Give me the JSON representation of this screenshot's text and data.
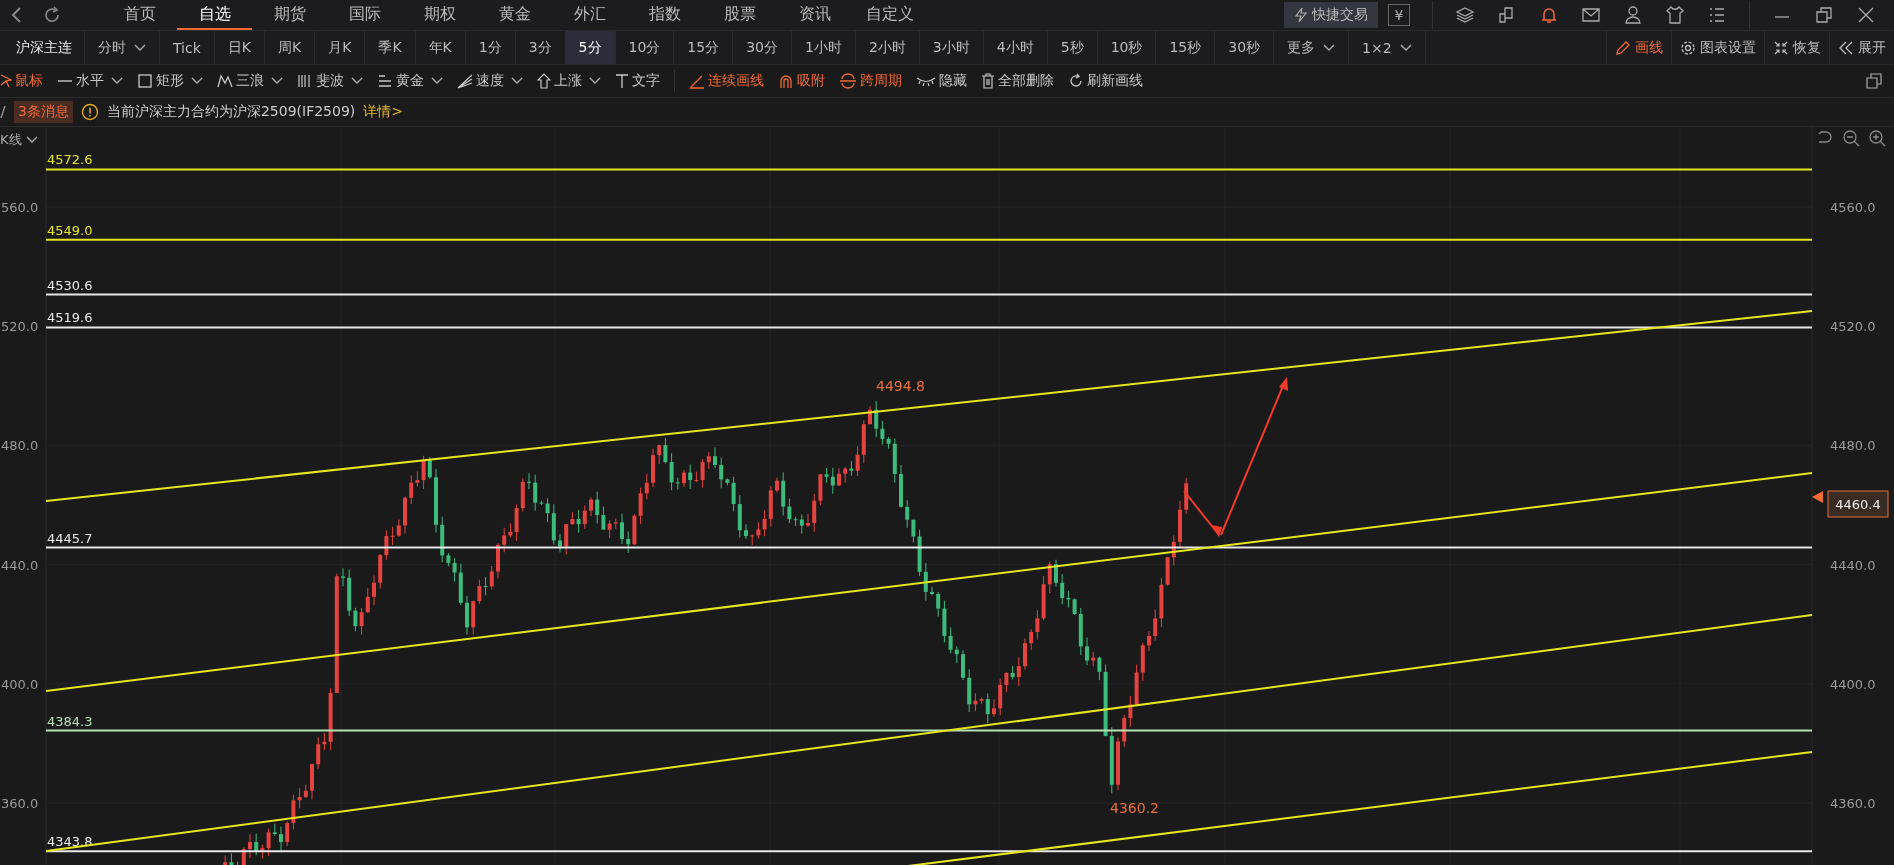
{
  "nav": {
    "tabs": [
      {
        "label": "首页",
        "selected": false
      },
      {
        "label": "自选",
        "selected": true
      },
      {
        "label": "期货",
        "selected": false
      },
      {
        "label": "国际",
        "selected": false
      },
      {
        "label": "期权",
        "selected": false
      },
      {
        "label": "黄金",
        "selected": false
      },
      {
        "label": "外汇",
        "selected": false
      },
      {
        "label": "指数",
        "selected": false
      },
      {
        "label": "股票",
        "selected": false
      },
      {
        "label": "资讯",
        "selected": false
      },
      {
        "label": "自定义",
        "selected": false
      }
    ],
    "quick_trade": "快捷交易",
    "currency": "¥"
  },
  "symbol": "沪深主连",
  "periods": [
    {
      "label": "分时",
      "selected": false,
      "has_menu": true
    },
    {
      "label": "Tick",
      "selected": false,
      "has_menu": false
    },
    {
      "label": "日K",
      "selected": false,
      "has_menu": false
    },
    {
      "label": "周K",
      "selected": false,
      "has_menu": false
    },
    {
      "label": "月K",
      "selected": false,
      "has_menu": false
    },
    {
      "label": "季K",
      "selected": false,
      "has_menu": false
    },
    {
      "label": "年K",
      "selected": false,
      "has_menu": false
    },
    {
      "label": "1分",
      "selected": false,
      "has_menu": false
    },
    {
      "label": "3分",
      "selected": false,
      "has_menu": false
    },
    {
      "label": "5分",
      "selected": true,
      "has_menu": false
    },
    {
      "label": "10分",
      "selected": false,
      "has_menu": false
    },
    {
      "label": "15分",
      "selected": false,
      "has_menu": false
    },
    {
      "label": "30分",
      "selected": false,
      "has_menu": false
    },
    {
      "label": "1小时",
      "selected": false,
      "has_menu": false
    },
    {
      "label": "2小时",
      "selected": false,
      "has_menu": false
    },
    {
      "label": "3小时",
      "selected": false,
      "has_menu": false
    },
    {
      "label": "4小时",
      "selected": false,
      "has_menu": false
    },
    {
      "label": "5秒",
      "selected": false,
      "has_menu": false
    },
    {
      "label": "10秒",
      "selected": false,
      "has_menu": false
    },
    {
      "label": "15秒",
      "selected": false,
      "has_menu": false
    },
    {
      "label": "30秒",
      "selected": false,
      "has_menu": false
    },
    {
      "label": "更多",
      "selected": false,
      "has_menu": true
    },
    {
      "label": "1×2",
      "selected": false,
      "has_menu": true
    }
  ],
  "chart_actions": [
    {
      "label": "画线",
      "active": true
    },
    {
      "label": "图表设置",
      "active": false
    },
    {
      "label": "恢复",
      "active": false
    },
    {
      "label": "展开",
      "active": false
    }
  ],
  "drawing_tools": [
    {
      "label": "鼠标",
      "active": true,
      "has_menu": false
    },
    {
      "label": "水平",
      "active": false,
      "has_menu": true
    },
    {
      "label": "矩形",
      "active": false,
      "has_menu": true
    },
    {
      "label": "三浪",
      "active": false,
      "has_menu": true
    },
    {
      "label": "斐波",
      "active": false,
      "has_menu": true
    },
    {
      "label": "黄金",
      "active": false,
      "has_menu": true
    },
    {
      "label": "速度",
      "active": false,
      "has_menu": true
    },
    {
      "label": "上涨",
      "active": false,
      "has_menu": true
    },
    {
      "label": "文字",
      "active": false,
      "has_menu": false
    }
  ],
  "drawing_actions": [
    {
      "label": "连续画线",
      "highlighted": true
    },
    {
      "label": "吸附",
      "highlighted": true
    },
    {
      "label": "跨周期",
      "highlighted": true
    },
    {
      "label": "隐藏",
      "highlighted": false
    },
    {
      "label": "全部删除",
      "highlighted": false
    },
    {
      "label": "刷新画线",
      "highlighted": false
    }
  ],
  "message_bar": {
    "badge": "3条消息",
    "text": "当前沪深主力合约为沪深2509(IF2509)",
    "link": "详情>"
  },
  "chart": {
    "indicator": "K线",
    "left_axis": [
      "560.0",
      "520.0",
      "480.0",
      "440.0",
      "400.0",
      "360.0"
    ],
    "right_axis": [
      "4560.0",
      "4520.0",
      "4480.0",
      "4440.0",
      "4400.0",
      "4360.0"
    ],
    "price_levels": [
      {
        "label": "4572.6",
        "color": "#e6e620"
      },
      {
        "label": "4549.0",
        "color": "#e6e620"
      },
      {
        "label": "4530.6",
        "color": "#e8e8e8"
      },
      {
        "label": "4519.6",
        "color": "#e8e8e8"
      },
      {
        "label": "4445.7",
        "color": "#e8e8e8"
      },
      {
        "label": "4384.3",
        "color": "#b4e0b4"
      },
      {
        "label": "4343.8",
        "color": "#e8e8e8"
      }
    ],
    "high_label": "4494.8",
    "low_label": "4360.2",
    "last_price": "4460.4"
  }
}
